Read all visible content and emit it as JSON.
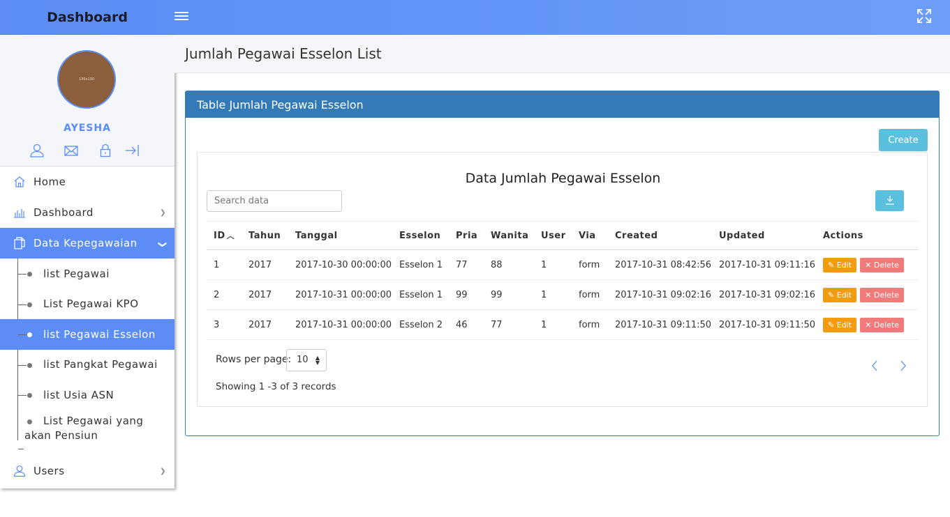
{
  "header": {
    "brand": "Dashboard"
  },
  "profile": {
    "avatar_text": "130x130",
    "name": "AYESHA"
  },
  "menu": {
    "home": "Home",
    "dashboard": "Dashboard",
    "kepegawaian": "Data Kepegawaian",
    "sub": {
      "s0": "list Pegawai",
      "s1": "List Pegawai KPO",
      "s2": "list Pegawai Esselon",
      "s3": "list Pangkat Pegawai",
      "s4": "list Usia ASN",
      "s5a": "List Pegawai yang",
      "s5b": "akan Pensiun"
    },
    "users": "Users"
  },
  "page": {
    "title": "Jumlah Pegawai Esselon List"
  },
  "panel": {
    "title": "Table Jumlah Pegawai Esselon",
    "create_label": "Create",
    "data_title": "Data Jumlah Pegawai Esselon",
    "search_placeholder": "Search data"
  },
  "table": {
    "headers": {
      "id": "ID",
      "tahun": "Tahun",
      "tanggal": "Tanggal",
      "esselon": "Esselon",
      "pria": "Pria",
      "wanita": "Wanita",
      "user": "User",
      "via": "Via",
      "created": "Created",
      "updated": "Updated",
      "actions": "Actions"
    },
    "rows": [
      {
        "id": "1",
        "tahun": "2017",
        "tanggal": "2017-10-30 00:00:00",
        "esselon": "Esselon 1",
        "pria": "77",
        "wanita": "88",
        "user": "1",
        "via": "form",
        "created": "2017-10-31 08:42:56",
        "updated": "2017-10-31 09:11:16"
      },
      {
        "id": "2",
        "tahun": "2017",
        "tanggal": "2017-10-31 00:00:00",
        "esselon": "Esselon 1",
        "pria": "99",
        "wanita": "99",
        "user": "1",
        "via": "form",
        "created": "2017-10-31 09:02:16",
        "updated": "2017-10-31 09:02:16"
      },
      {
        "id": "3",
        "tahun": "2017",
        "tanggal": "2017-10-31 00:00:00",
        "esselon": "Esselon 2",
        "pria": "46",
        "wanita": "77",
        "user": "1",
        "via": "form",
        "created": "2017-10-31 09:11:50",
        "updated": "2017-10-31 09:11:50"
      }
    ],
    "edit_label": "Edit",
    "delete_label": "Delete"
  },
  "footer": {
    "rows_per_page_label": "Rows per page:",
    "rows_per_page_value": "10",
    "showing": "Showing 1 -3 of 3 records"
  },
  "colors": {
    "accent": "#5b8df4",
    "panel": "#337ab7",
    "info": "#5bc0de",
    "warning": "#f39c12",
    "danger": "#f17b7b"
  }
}
